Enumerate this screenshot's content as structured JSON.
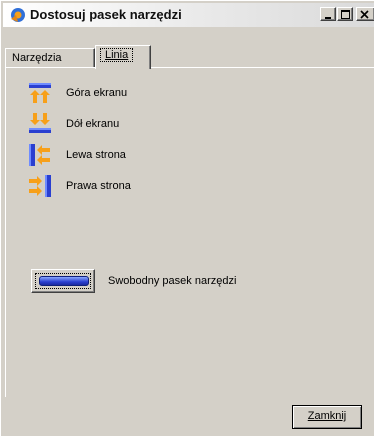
{
  "window": {
    "title": "Dostosuj pasek narzędzi"
  },
  "tabs": [
    {
      "label": "Narzędzia",
      "active": false
    },
    {
      "label": "Linia",
      "active": true
    }
  ],
  "items": [
    {
      "label": "Góra ekranu",
      "icon": "dock-top-icon"
    },
    {
      "label": "Dół ekranu",
      "icon": "dock-bottom-icon"
    },
    {
      "label": "Lewa strona",
      "icon": "dock-left-icon"
    },
    {
      "label": "Prawa strona",
      "icon": "dock-right-icon"
    }
  ],
  "floating": {
    "label": "Swobodny pasek narzędzi",
    "icon": "floating-toolbar-icon"
  },
  "footer": {
    "close_label": "Zamknij"
  },
  "colors": {
    "face": "#d4d0c8",
    "blue": "#2a3fd0",
    "orange": "#f7a01a"
  }
}
